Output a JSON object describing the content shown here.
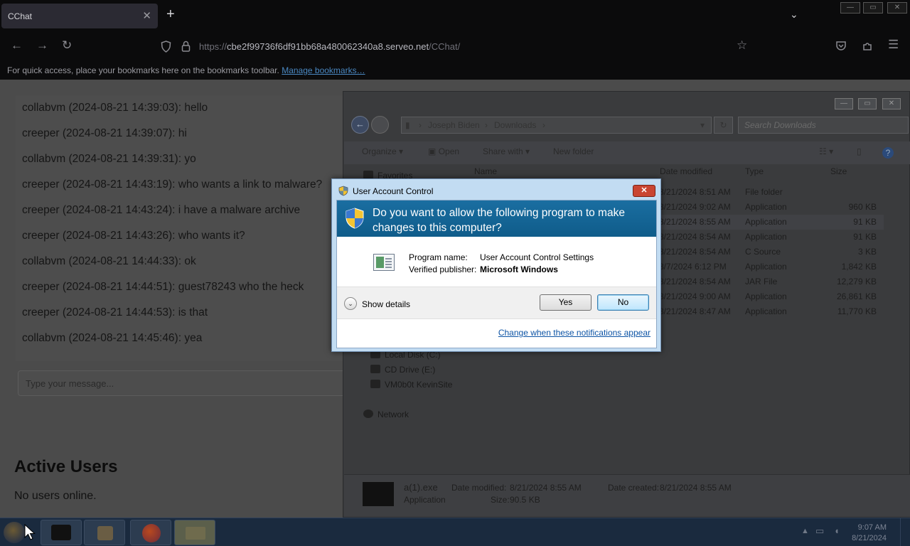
{
  "browser": {
    "tab_title": "CChat",
    "tab_close": "✕",
    "new_tab": "+",
    "list_tabs": "⌄",
    "url_prefix": "https://",
    "url_host": "cbe2f99736f6df91bb68a480062340a8.serveo.net",
    "url_path": "/CChat/",
    "bookmarks_hint": "For quick access, place your bookmarks here on the bookmarks toolbar.",
    "bookmarks_link": "Manage bookmarks…"
  },
  "chat": {
    "messages": [
      "collabvm (2024-08-21 14:39:03): hello",
      "creeper (2024-08-21 14:39:07): hi",
      "collabvm (2024-08-21 14:39:31): yo",
      "creeper (2024-08-21 14:43:19): who wants a link to malware?",
      "creeper (2024-08-21 14:43:24): i have a malware archive",
      "creeper (2024-08-21 14:43:26): who wants it?",
      "collabvm (2024-08-21 14:44:33): ok",
      "creeper (2024-08-21 14:44:51): guest78243 who the heck",
      "creeper (2024-08-21 14:44:53): is that",
      "collabvm (2024-08-21 14:45:46): yea"
    ],
    "input_placeholder": "Type your message...",
    "active_users_title": "Active Users",
    "active_users_status": "No users online."
  },
  "explorer": {
    "breadcrumb": [
      "Joseph Biden",
      "Downloads"
    ],
    "search_placeholder": "Search Downloads",
    "toolbar": {
      "organize": "Organize",
      "open": "Open",
      "share_with": "Share with",
      "new_folder": "New folder"
    },
    "columns": {
      "name": "Name",
      "date": "Date modified",
      "type": "Type",
      "size": "Size"
    },
    "sidebar": {
      "favorites": "Favorites",
      "local_disk": "Local Disk (C:)",
      "cd_drive": "CD Drive (E:)",
      "share": "VM0b0t KevinSite",
      "network": "Network"
    },
    "files": [
      {
        "date": "8/21/2024 8:51 AM",
        "type": "File folder",
        "size": ""
      },
      {
        "date": "8/21/2024 9:02 AM",
        "type": "Application",
        "size": "960 KB"
      },
      {
        "date": "8/21/2024 8:55 AM",
        "type": "Application",
        "size": "91 KB"
      },
      {
        "date": "8/21/2024 8:54 AM",
        "type": "Application",
        "size": "91 KB"
      },
      {
        "date": "8/21/2024 8:54 AM",
        "type": "C Source",
        "size": "3 KB"
      },
      {
        "date": "8/7/2024 6:12 PM",
        "type": "Application",
        "size": "1,842 KB"
      },
      {
        "date": "8/21/2024 8:54 AM",
        "type": "JAR File",
        "size": "12,279 KB"
      },
      {
        "date": "8/21/2024 9:00 AM",
        "type": "Application",
        "size": "26,861 KB"
      },
      {
        "date": "8/21/2024 8:47 AM",
        "type": "Application",
        "size": "11,770 KB"
      }
    ],
    "details": {
      "file_name": "a(1).exe",
      "file_type": "Application",
      "modified_label": "Date modified:",
      "modified_value": "8/21/2024 8:55 AM",
      "size_label": "Size:",
      "size_value": "90.5 KB",
      "created_label": "Date created:",
      "created_value": "8/21/2024 8:55 AM"
    }
  },
  "uac": {
    "window_title": "User Account Control",
    "close_glyph": "✕",
    "question": "Do you want to allow the following program to make changes to this computer?",
    "program_name_label": "Program name:",
    "program_name_value": "User Account Control Settings",
    "publisher_label": "Verified publisher:",
    "publisher_value": "Microsoft Windows",
    "show_details": "Show details",
    "yes": "Yes",
    "no": "No",
    "change_link": "Change when these notifications appear"
  },
  "taskbar": {
    "time": "9:07 AM",
    "date": "8/21/2024"
  }
}
